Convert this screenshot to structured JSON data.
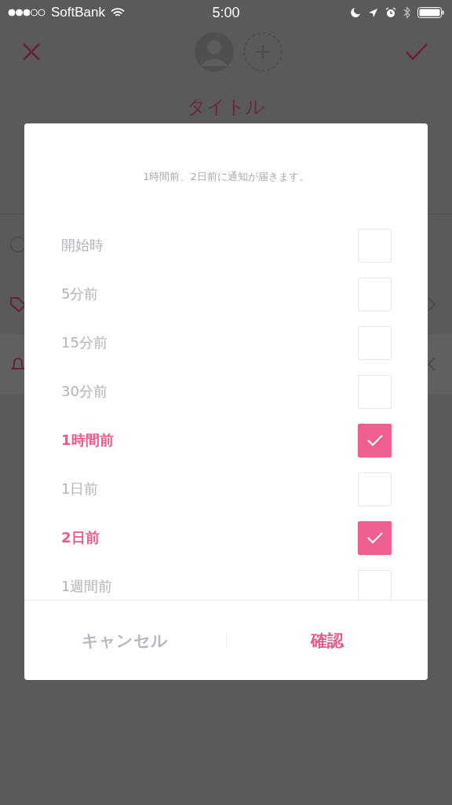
{
  "status_bar": {
    "carrier": "SoftBank",
    "time": "5:00"
  },
  "header": {
    "title": "タイトル"
  },
  "dialog": {
    "message": "1時間前、2日前に通知が届きます。",
    "options": [
      {
        "label": "開始時",
        "checked": false
      },
      {
        "label": "5分前",
        "checked": false
      },
      {
        "label": "15分前",
        "checked": false
      },
      {
        "label": "30分前",
        "checked": false
      },
      {
        "label": "1時間前",
        "checked": true
      },
      {
        "label": "1日前",
        "checked": false
      },
      {
        "label": "2日前",
        "checked": true
      },
      {
        "label": "1週間前",
        "checked": false
      }
    ],
    "buttons": [
      {
        "label": "キャンセル",
        "kind": "cancel"
      },
      {
        "label": "確認",
        "kind": "confirm"
      }
    ]
  }
}
